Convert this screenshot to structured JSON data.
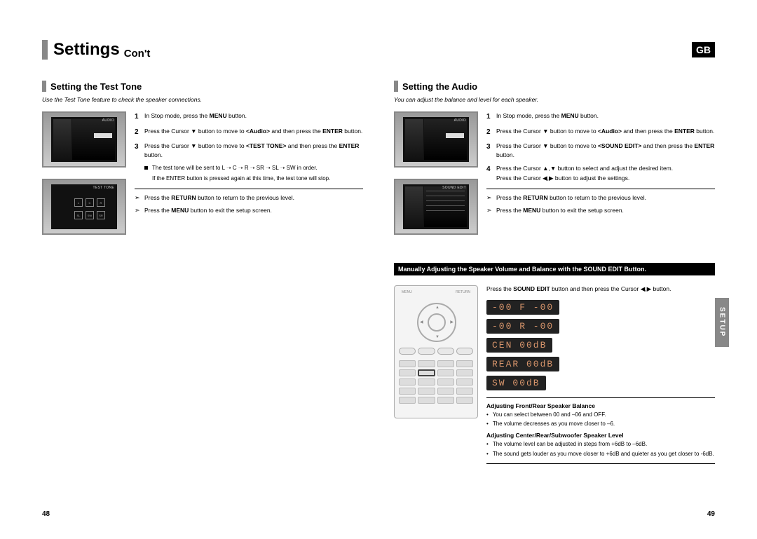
{
  "header": {
    "title": "Settings",
    "subtitle": "Con't",
    "locale_badge": "GB"
  },
  "side_tab": "SETUP",
  "pages": {
    "left_num": "48",
    "right_num": "49"
  },
  "left": {
    "section_title": "Setting the Test Tone",
    "section_desc": "Use the Test Tone feature to check the speaker connections.",
    "thumb1_tag": "AUDIO",
    "thumb2_tag": "TEST TONE",
    "steps": {
      "s1": "In Stop mode, press the <b>MENU</b> button.",
      "s2": "Press the Cursor ▼ button to move to <b>&lt;Audio&gt;</b> and then press the <b>ENTER</b> button.",
      "s3": "Press the Cursor ▼ button to move to <b>&lt;TEST TONE&gt;</b> and then press the <b>ENTER</b> button.",
      "bullet_a": "The test tone will be sent to L ➝ C ➝ R ➝ SR ➝ SL ➝ SW in order.",
      "bullet_b": "If the ENTER button is pressed again at this time, the test tone will stop.",
      "ret": "Press the <b>RETURN</b> button to return to the previous level.",
      "menu": "Press the <b>MENU</b> button to exit the setup screen."
    }
  },
  "right": {
    "section_title": "Setting the Audio",
    "section_desc": "You can adjust the balance and level for each speaker.",
    "thumb1_tag": "AUDIO",
    "thumb2_tag": "SOUND EDIT",
    "steps": {
      "s1": "In Stop mode, press the <b>MENU</b> button.",
      "s2": "Press the Cursor ▼ button to move to <b>&lt;Audio&gt;</b> and then press the <b>ENTER</b> button.",
      "s3": "Press the Cursor ▼ button to move to <b>&lt;SOUND EDIT&gt;</b> and then press the <b>ENTER</b> button.",
      "s4": "Press the Cursor ▲,▼ button to select and adjust the desired item.",
      "s4b": "Press the Cursor ◀,▶ button to adjust the settings.",
      "ret": "Press the <b>RETURN</b> button to return to the previous level.",
      "menu": "Press the <b>MENU</b> button to exit the setup screen."
    },
    "banner": "Manually Adjusting the Speaker Volume and Balance with the SOUND EDIT Button.",
    "sound_edit_instr": "Press the <b>SOUND EDIT</b> button and then press the Cursor ◀,▶ button.",
    "displays": {
      "d1": "-00 F -00",
      "d2": "-00 R -00",
      "d3": "CEN  00dB",
      "d4": "REAR 00dB",
      "d5": "SW   00dB"
    },
    "adj1_head": "Adjusting Front/Rear Speaker Balance",
    "adj1_b1": "You can select between 00 and –06 and OFF.",
    "adj1_b2": "The volume decreases as you move closer to –6.",
    "adj2_head": "Adjusting Center/Rear/Subwoofer Speaker Level",
    "adj2_b1": "The volume level can be adjusted in steps from +6dB to –6dB.",
    "adj2_b2": "The sound gets louder as you move closer to +6dB and quieter as you get closer to -6dB."
  }
}
